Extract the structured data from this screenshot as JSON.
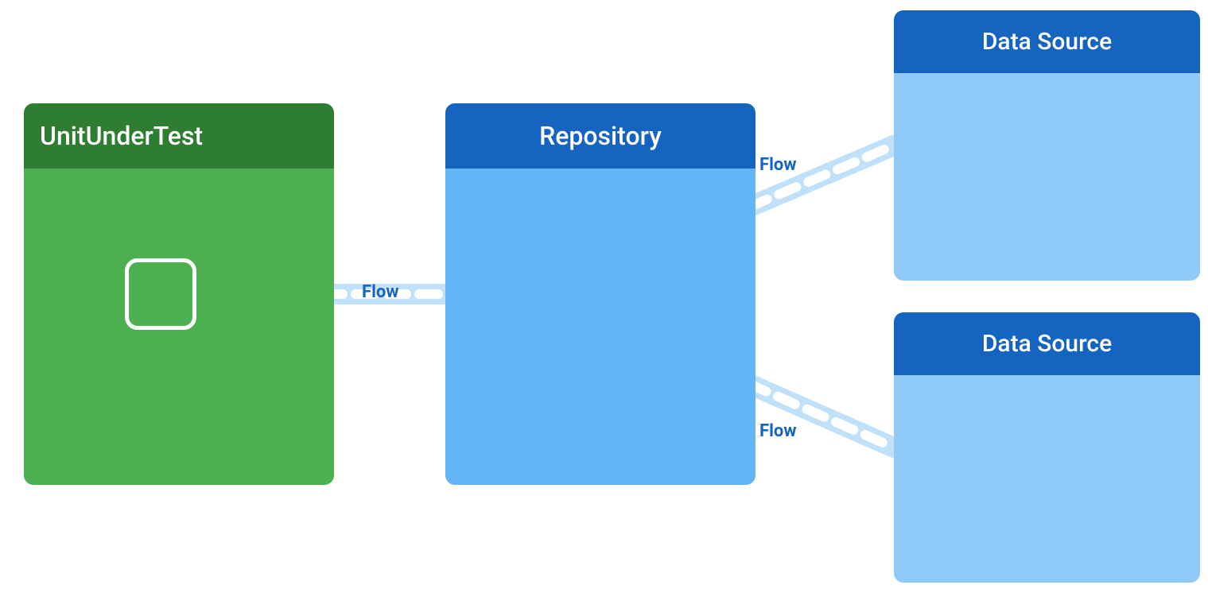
{
  "diagram": {
    "unit_box": {
      "header": "UnitUnderTest",
      "bg_header": "#2e7d32",
      "bg_body": "#4caf50"
    },
    "repo_box": {
      "header": "Repository",
      "bg_header": "#1565c0",
      "bg_body": "#64b5f6"
    },
    "data_source_top": {
      "header": "Data Source",
      "bg_header": "#1565c0",
      "bg_body": "#90caf9"
    },
    "data_source_bottom": {
      "header": "Data Source",
      "bg_header": "#1565c0",
      "bg_body": "#90caf9"
    },
    "flow_labels": {
      "main": "Flow",
      "top": "Flow",
      "bottom": "Flow"
    }
  }
}
